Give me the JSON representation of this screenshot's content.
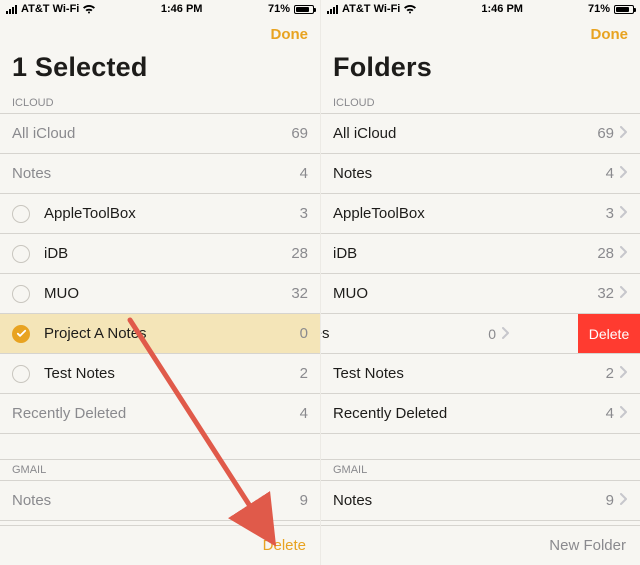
{
  "status": {
    "carrier": "AT&T Wi-Fi",
    "time": "1:46 PM",
    "battery_pct": "71%"
  },
  "left": {
    "done_label": "Done",
    "title": "1 Selected",
    "section1_label": "ICLOUD",
    "folders": [
      {
        "name": "All iCloud",
        "count": "69",
        "selectable": false,
        "selected": false,
        "dimmed": true
      },
      {
        "name": "Notes",
        "count": "4",
        "selectable": false,
        "selected": false,
        "dimmed": true
      },
      {
        "name": "AppleToolBox",
        "count": "3",
        "selectable": true,
        "selected": false,
        "dimmed": false
      },
      {
        "name": "iDB",
        "count": "28",
        "selectable": true,
        "selected": false,
        "dimmed": false
      },
      {
        "name": "MUO",
        "count": "32",
        "selectable": true,
        "selected": false,
        "dimmed": false
      },
      {
        "name": "Project A Notes",
        "count": "0",
        "selectable": true,
        "selected": true,
        "dimmed": false
      },
      {
        "name": "Test Notes",
        "count": "2",
        "selectable": true,
        "selected": false,
        "dimmed": false
      },
      {
        "name": "Recently Deleted",
        "count": "4",
        "selectable": false,
        "selected": false,
        "dimmed": true
      }
    ],
    "section2_label": "GMAIL",
    "gmail_folders": [
      {
        "name": "Notes",
        "count": "9",
        "dimmed": true
      }
    ],
    "toolbar_action": "Delete"
  },
  "right": {
    "done_label": "Done",
    "title": "Folders",
    "section1_label": "ICLOUD",
    "folders": [
      {
        "name": "All iCloud",
        "count": "69"
      },
      {
        "name": "Notes",
        "count": "4"
      },
      {
        "name": "AppleToolBox",
        "count": "3"
      },
      {
        "name": "iDB",
        "count": "28"
      },
      {
        "name": "MUO",
        "count": "32"
      }
    ],
    "swipe_folder": {
      "name": "A Notes",
      "count": "0",
      "action": "Delete"
    },
    "folders2": [
      {
        "name": "Test Notes",
        "count": "2"
      },
      {
        "name": "Recently Deleted",
        "count": "4"
      }
    ],
    "section2_label": "GMAIL",
    "gmail_folders": [
      {
        "name": "Notes",
        "count": "9"
      }
    ],
    "toolbar_action": "New Folder"
  }
}
